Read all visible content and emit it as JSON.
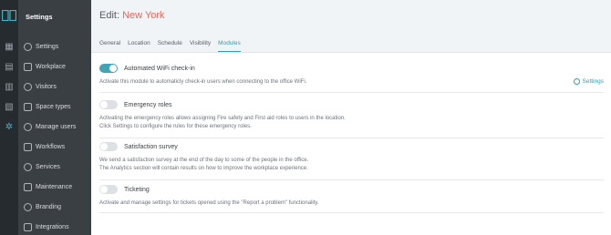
{
  "sidebar": {
    "title": "Settings",
    "items": [
      {
        "label": "Settings",
        "icon": "settings-icon"
      },
      {
        "label": "Workplace",
        "icon": "workplace-icon"
      },
      {
        "label": "Visitors",
        "icon": "visitors-icon"
      },
      {
        "label": "Space types",
        "icon": "space-types-icon"
      },
      {
        "label": "Manage users",
        "icon": "users-icon"
      },
      {
        "label": "Workflows",
        "icon": "workflows-icon"
      },
      {
        "label": "Services",
        "icon": "services-icon"
      },
      {
        "label": "Maintenance",
        "icon": "maintenance-icon"
      },
      {
        "label": "Branding",
        "icon": "branding-icon"
      },
      {
        "label": "Integrations",
        "icon": "integrations-icon"
      }
    ]
  },
  "header": {
    "edit_prefix": "Edit:",
    "location": "New York"
  },
  "tabs": [
    {
      "label": "General",
      "active": false
    },
    {
      "label": "Location",
      "active": false
    },
    {
      "label": "Schedule",
      "active": false
    },
    {
      "label": "Visibility",
      "active": false
    },
    {
      "label": "Modules",
      "active": true
    }
  ],
  "modules": [
    {
      "name": "Automated WiFi check-in",
      "enabled": true,
      "description_lines": [
        "Activate this module to automaticly check-in users when connecting to the office WiFi."
      ],
      "settings_label": "Settings"
    },
    {
      "name": "Emergency roles",
      "enabled": false,
      "description_lines": [
        "Activating the emergency roles allows assigning Fire safety and First aid roles to users in the location.",
        "Click Settings to configure the rules for these emergency roles."
      ]
    },
    {
      "name": "Satisfaction survey",
      "enabled": false,
      "description_lines": [
        "We send a satisfaction survey at the end of the day to some of the people in the office.",
        "The Analytics section will contain results on how to improve the workplace experience."
      ]
    },
    {
      "name": "Ticketing",
      "enabled": false,
      "description_lines": [
        "Activate and manage settings for tickets opened using the \"Report a problem\" functionality."
      ]
    }
  ],
  "colors": {
    "accent": "#2d9fb3",
    "title_accent": "#e4675c",
    "sidebar_bg": "#3a3f44",
    "rail_bg": "#262b30"
  }
}
